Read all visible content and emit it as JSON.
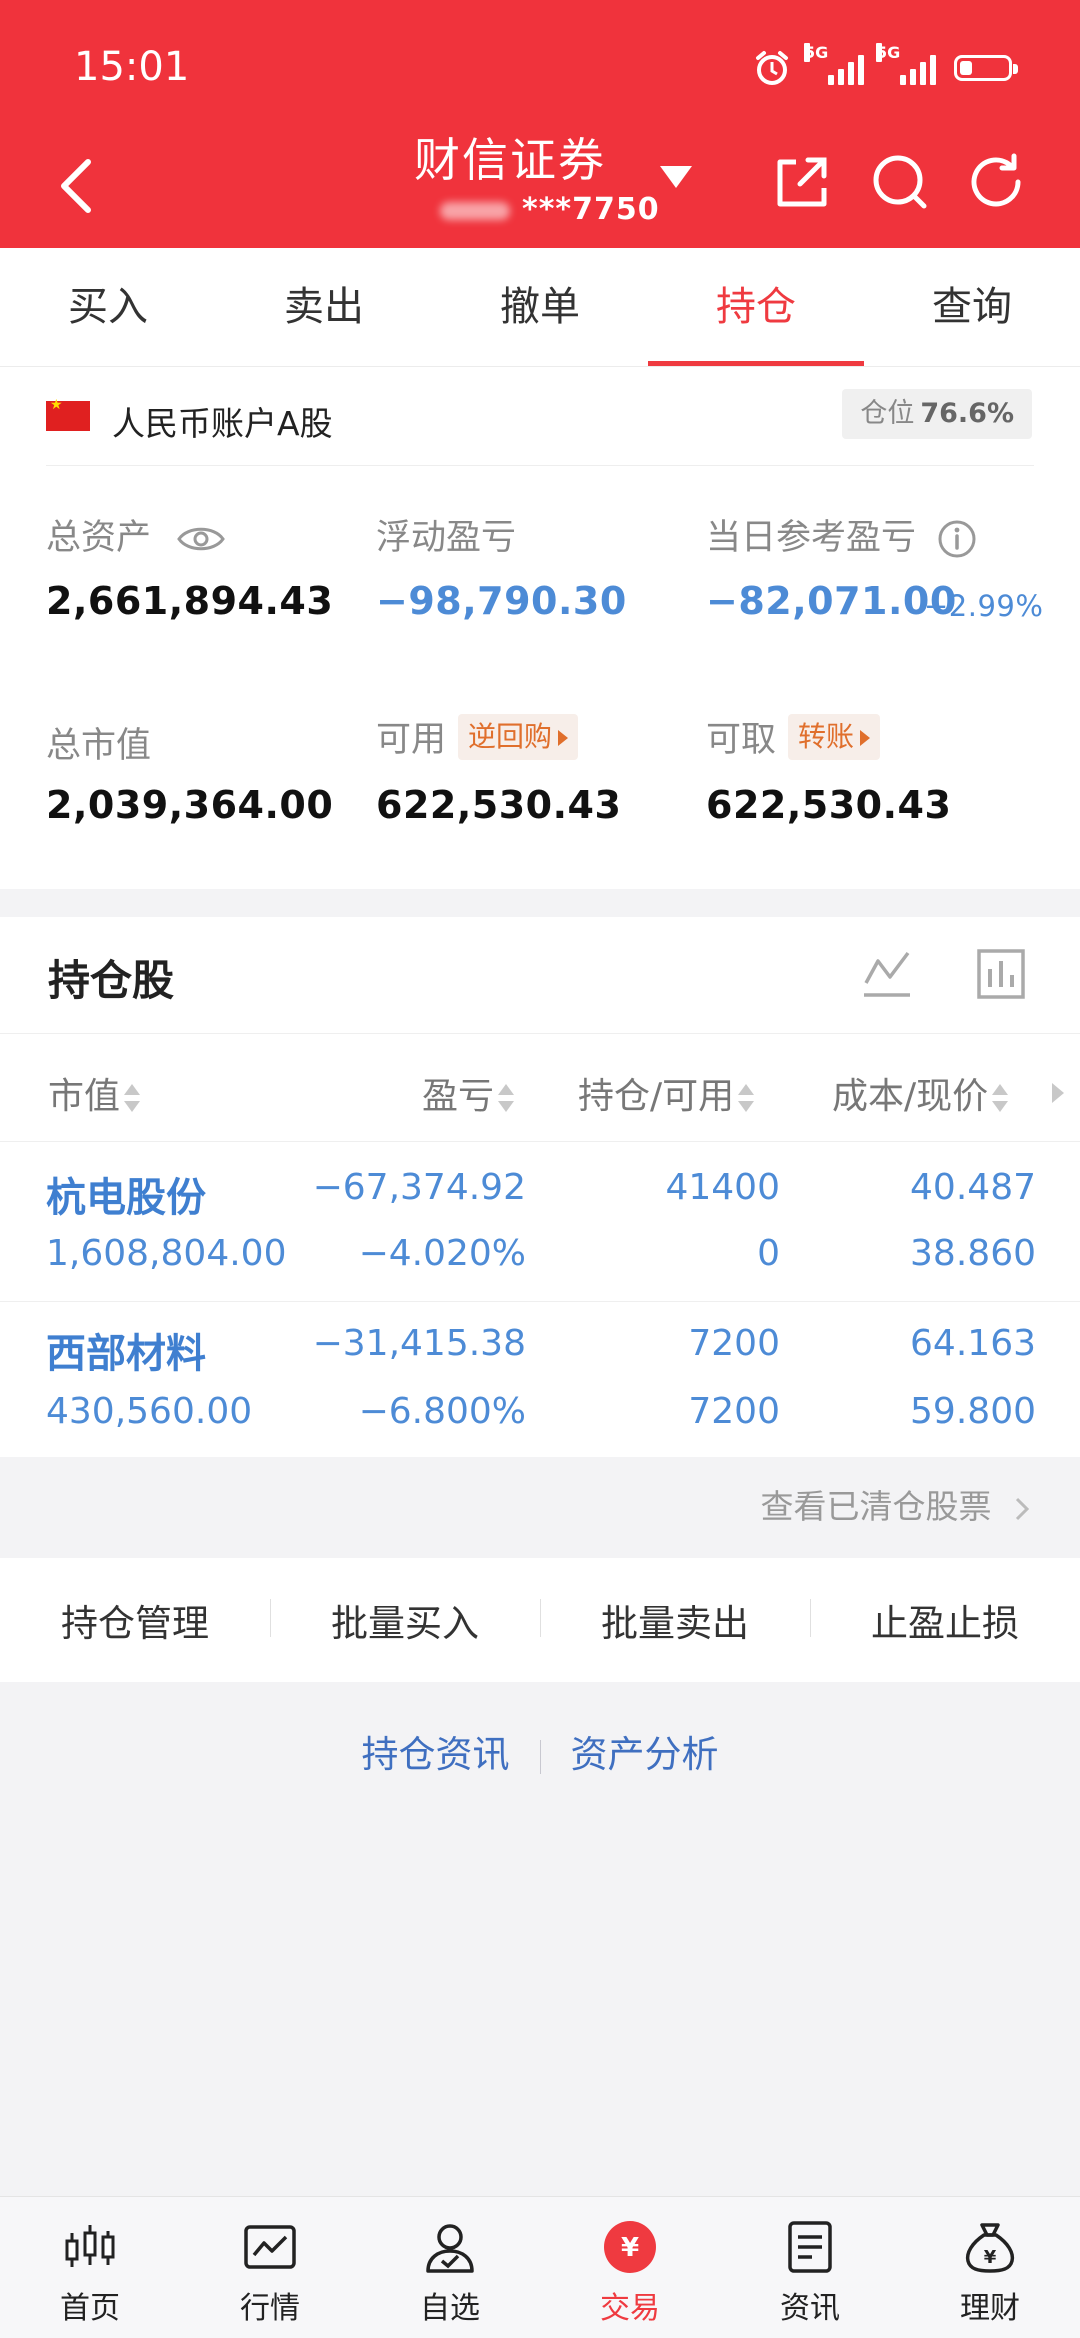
{
  "status": {
    "time": "15:01",
    "network_1": "5G",
    "network_2": "5G"
  },
  "header": {
    "title": "财信证券",
    "account_masked": "***7750"
  },
  "tabs": [
    {
      "label": "买入"
    },
    {
      "label": "卖出"
    },
    {
      "label": "撤单"
    },
    {
      "label": "持仓",
      "active": true
    },
    {
      "label": "查询"
    }
  ],
  "account": {
    "name": "人民币账户A股",
    "position_label": "仓位",
    "position_value": "76.6%",
    "total_assets_label": "总资产",
    "total_assets": "2,661,894.43",
    "floating_pnl_label": "浮动盈亏",
    "floating_pnl": "−98,790.30",
    "daily_pnl_label": "当日参考盈亏",
    "daily_pnl": "−82,071.00",
    "daily_pnl_pct": "−2.99%",
    "market_value_label": "总市值",
    "market_value": "2,039,364.00",
    "available_label": "可用",
    "available_action": "逆回购",
    "available": "622,530.43",
    "withdrawable_label": "可取",
    "withdrawable_action": "转账",
    "withdrawable": "622,530.43"
  },
  "holdings": {
    "title": "持仓股",
    "headers": {
      "market_value": "市值",
      "pnl": "盈亏",
      "position": "持仓/可用",
      "cost": "成本/现价"
    },
    "rows": [
      {
        "name": "杭电股份",
        "market_value": "1,608,804.00",
        "pnl": "−67,374.92",
        "pnl_pct": "−4.020%",
        "position": "41400",
        "available": "0",
        "cost": "40.487",
        "price": "38.860"
      },
      {
        "name": "西部材料",
        "market_value": "430,560.00",
        "pnl": "−31,415.38",
        "pnl_pct": "−6.800%",
        "position": "7200",
        "available": "7200",
        "cost": "64.163",
        "price": "59.800"
      }
    ]
  },
  "cleared_link": "查看已清仓股票",
  "actions": [
    {
      "label": "持仓管理"
    },
    {
      "label": "批量买入"
    },
    {
      "label": "批量卖出"
    },
    {
      "label": "止盈止损"
    }
  ],
  "links": {
    "news": "持仓资讯",
    "analysis": "资产分析"
  },
  "bottom_nav": [
    {
      "label": "首页",
      "icon": "candlestick-icon"
    },
    {
      "label": "行情",
      "icon": "market-chart-icon"
    },
    {
      "label": "自选",
      "icon": "user-check-icon"
    },
    {
      "label": "交易",
      "icon": "yen-coin-icon",
      "active": true
    },
    {
      "label": "资讯",
      "icon": "document-icon"
    },
    {
      "label": "理财",
      "icon": "money-bag-icon"
    }
  ],
  "colors": {
    "brand_red": "#f0333c",
    "loss_blue": "#4d8bd6",
    "accent_orange": "#e06f2c"
  }
}
